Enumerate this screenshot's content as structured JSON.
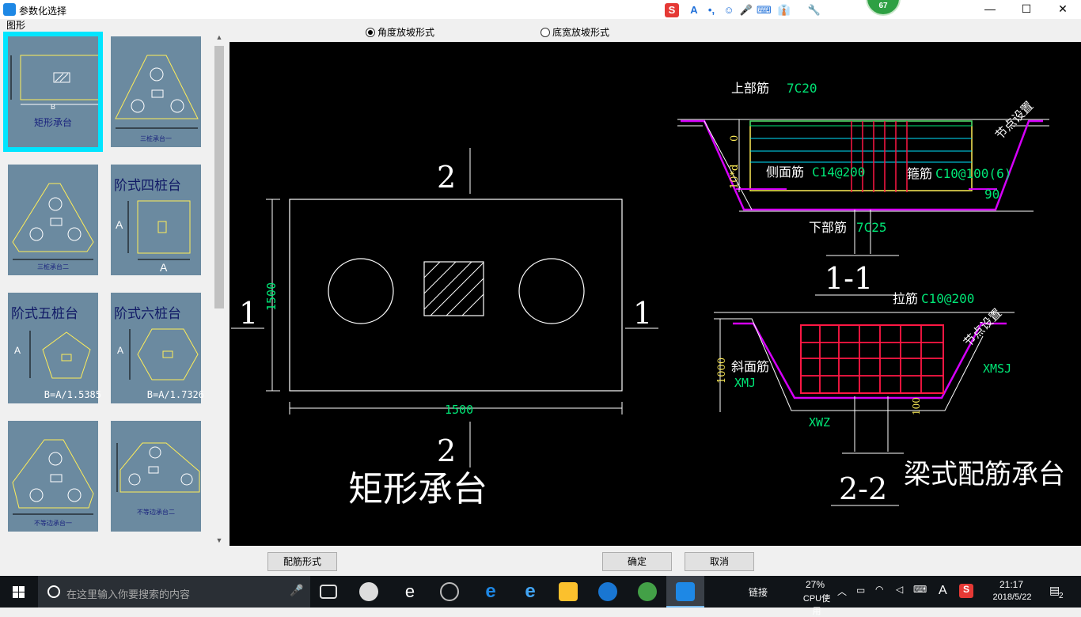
{
  "window": {
    "title": "参数化选择",
    "controls": [
      "—",
      "☐",
      "✕"
    ]
  },
  "ime_toolbar": {
    "items": [
      "S",
      "A",
      "•,",
      "☺",
      "🎤",
      "⌨",
      "👔",
      "🔧"
    ],
    "badge": "67"
  },
  "left_panel": {
    "label": "图形",
    "thumbnails": [
      {
        "caption": "矩形承台",
        "dim": "B",
        "selected": true
      },
      {
        "caption": "三桩承台一"
      },
      {
        "caption": "三桩承台二"
      },
      {
        "caption": "阶式四桩台",
        "dim": "A",
        "dim2": "A"
      },
      {
        "caption": "阶式五桩台",
        "dim": "A",
        "formula": "B=A/1.5385"
      },
      {
        "caption": "阶式六桩台",
        "dim": "A",
        "formula": "B=A/1.7326"
      },
      {
        "caption": "不等边承台一"
      },
      {
        "caption": "不等边承台二"
      }
    ]
  },
  "radio_options": [
    {
      "label": "角度放坡形式",
      "checked": true
    },
    {
      "label": "底宽放坡形式",
      "checked": false
    }
  ],
  "drawing": {
    "section_top": "2",
    "section_bottom": "2",
    "section_left": "1",
    "section_right": "1",
    "dim_height": "1500",
    "dim_width": "1500",
    "main_title": "矩形承台",
    "s11": {
      "top_rebar_label": "上部筋",
      "top_rebar_value": "7C20",
      "zero": "0",
      "side_label": "侧面筋",
      "side_value": "C14@200",
      "stirrup_label": "箍筋",
      "stirrup_value": "C10@100(6)",
      "vert_label": "10*d",
      "node_label": "节点设置",
      "angle": "90",
      "bottom_label": "下部筋",
      "bottom_value": "7C25",
      "title": "1-1"
    },
    "s22": {
      "tie_label": "拉筋",
      "tie_value": "C10@200",
      "node_label": "节点设置",
      "slope_label": "斜面筋",
      "xmj": "XMJ",
      "xmsj": "XMSJ",
      "xwz": "XWZ",
      "dim_1000": "1000",
      "dim_100": "100",
      "title": "2-2"
    },
    "beam_title": "梁式配筋承台"
  },
  "buttons": {
    "rebar_form": "配筋形式",
    "ok": "确定",
    "cancel": "取消"
  },
  "taskbar": {
    "search_placeholder": "在这里输入你要搜索的内容",
    "link_label": "链接",
    "cpu_percent": "27%",
    "cpu_label": "CPU使用",
    "ime_indicator": "A",
    "time": "21:17",
    "date": "2018/5/22",
    "notification_count": "2"
  }
}
